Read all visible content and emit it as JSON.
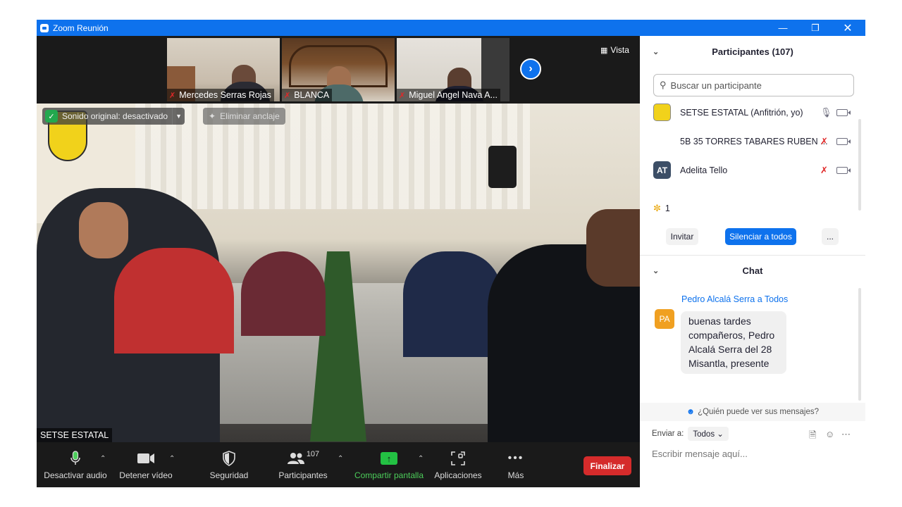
{
  "window": {
    "title": "Zoom Reunión"
  },
  "thumbnails": [
    {
      "name": "Mercedes Serras Rojas",
      "muted": true
    },
    {
      "name": "BLANCA",
      "muted": true
    },
    {
      "name": "Miguel Angel Nava A...",
      "muted": true
    }
  ],
  "view_label": "Vista",
  "speaker": {
    "name": "SETSE ESTATAL"
  },
  "overlays": {
    "original_sound": "Sonido original: desactivado",
    "unpin": "Eliminar anclaje"
  },
  "toolbar": {
    "mute": "Desactivar audio",
    "video": "Detener vídeo",
    "security": "Seguridad",
    "participants": "Participantes",
    "participants_count": "107",
    "share": "Compartir pantalla",
    "apps": "Aplicaciones",
    "more": "Más",
    "end": "Finalizar"
  },
  "participants_panel": {
    "title": "Participantes (107)",
    "search_placeholder": "Buscar un participante",
    "items": [
      {
        "avatar_text": "",
        "name": "SETSE ESTATAL (Anfitrión, yo)",
        "mic": "on"
      },
      {
        "avatar_text": "",
        "name": "5B 35 TORRES TABARES RUBEN ...",
        "mic": "muted"
      },
      {
        "avatar_text": "AT",
        "name": "Adelita Tello",
        "mic": "muted"
      }
    ],
    "reaction_count": "1",
    "invite": "Invitar",
    "mute_all": "Silenciar a todos",
    "more": "..."
  },
  "chat": {
    "title": "Chat",
    "messages": [
      {
        "sender": "Pedro Alcalá Serra a Todos",
        "avatar": "PA",
        "text": "buenas tardes compañeros, Pedro Alcalá Serra del 28 Misantla, presente"
      }
    ],
    "who_can_see": "¿Quién puede ver sus mensajes?",
    "send_to_label": "Enviar a:",
    "send_to_value": "Todos",
    "input_placeholder": "Escribir mensaje aquí..."
  },
  "colors": {
    "accent": "#0e72ed",
    "end": "#d52b2b",
    "share": "#23c143",
    "muted": "#e02828"
  }
}
